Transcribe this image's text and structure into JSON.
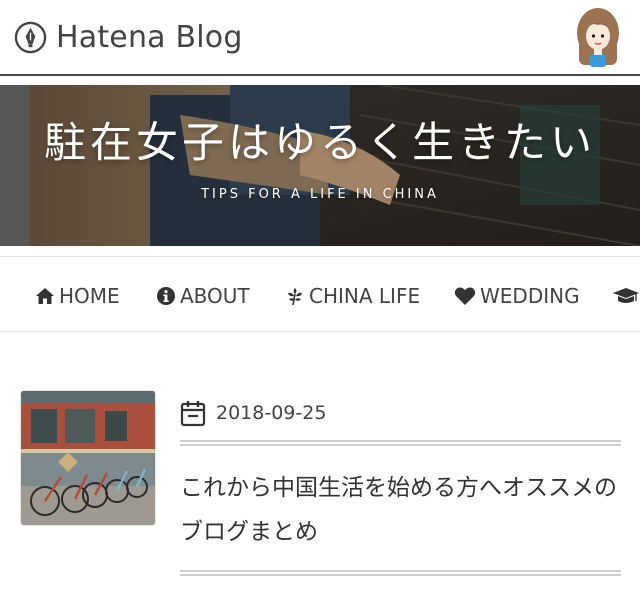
{
  "header": {
    "logo_text": "Hatena Blog",
    "logo_icon": "fountain-pen-icon",
    "avatar": "author-avatar"
  },
  "hero": {
    "title": "駐在女子はゆるく生きたい",
    "tagline": "TIPS FOR A LIFE IN CHINA"
  },
  "nav": {
    "items": [
      {
        "label": "HOME",
        "icon": "home-icon"
      },
      {
        "label": "ABOUT",
        "icon": "info-icon"
      },
      {
        "label": "CHINA LIFE",
        "icon": "leaf-icon"
      },
      {
        "label": "WEDDING",
        "icon": "heart-icon"
      },
      {
        "label": "",
        "icon": "graduation-cap-icon"
      }
    ]
  },
  "post": {
    "date": "2018-09-25",
    "date_icon": "calendar-icon",
    "title": "これから中国生活を始める方へオススメのブログまとめ",
    "thumbnail": "bicycles-street-photo"
  },
  "colors": {
    "text": "#444444",
    "header_rule": "#4a4a4a",
    "divider": "#cfcfcf"
  }
}
